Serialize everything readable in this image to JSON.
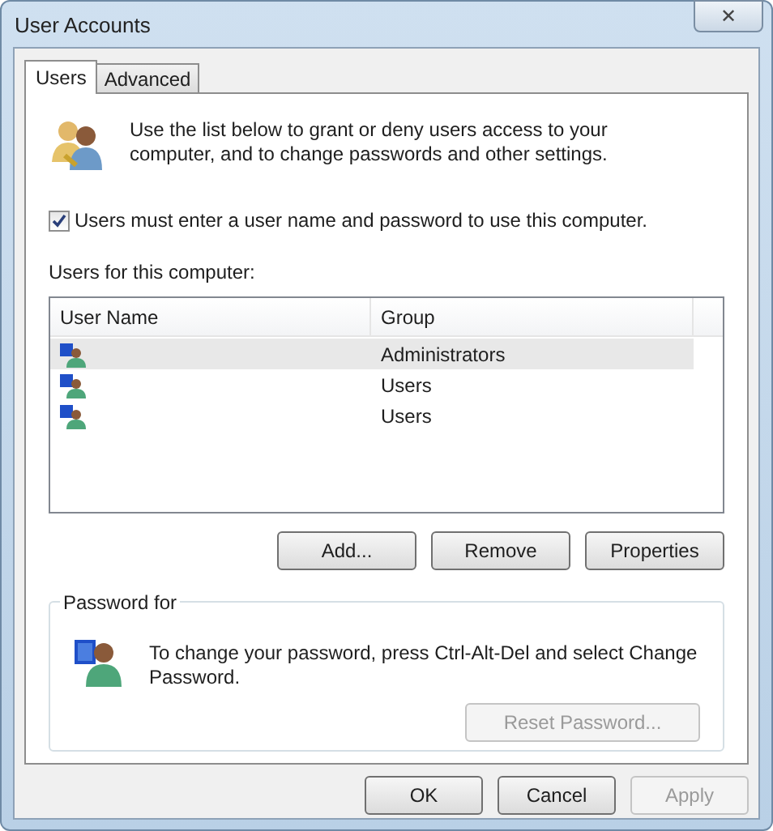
{
  "window": {
    "title": "User Accounts",
    "close_label": "✕"
  },
  "tabs": [
    {
      "label": "Users",
      "selected": true
    },
    {
      "label": "Advanced",
      "selected": false
    }
  ],
  "intro": "Use the list below to grant or deny users access to your computer, and to change passwords and other settings.",
  "require_login": {
    "label": "Users must enter a user name and password to use this computer.",
    "checked": true
  },
  "list_label": "Users for this computer:",
  "table": {
    "columns": [
      "User Name",
      "Group"
    ],
    "rows": [
      {
        "group": "Administrators",
        "selected": true
      },
      {
        "group": "Users",
        "selected": false
      },
      {
        "group": "Users",
        "selected": false
      }
    ]
  },
  "list_buttons": [
    {
      "label": "Add...",
      "disabled": false
    },
    {
      "label": "Remove",
      "disabled": false
    },
    {
      "label": "Properties",
      "disabled": false
    }
  ],
  "password_group": {
    "legend": "Password for",
    "text": "To change your password, press Ctrl-Alt-Del and select Change Password.",
    "button": {
      "label": "Reset Password...",
      "disabled": true
    }
  },
  "dialog_buttons": [
    {
      "label": "OK",
      "disabled": false
    },
    {
      "label": "Cancel",
      "disabled": false
    },
    {
      "label": "Apply",
      "disabled": true
    }
  ]
}
